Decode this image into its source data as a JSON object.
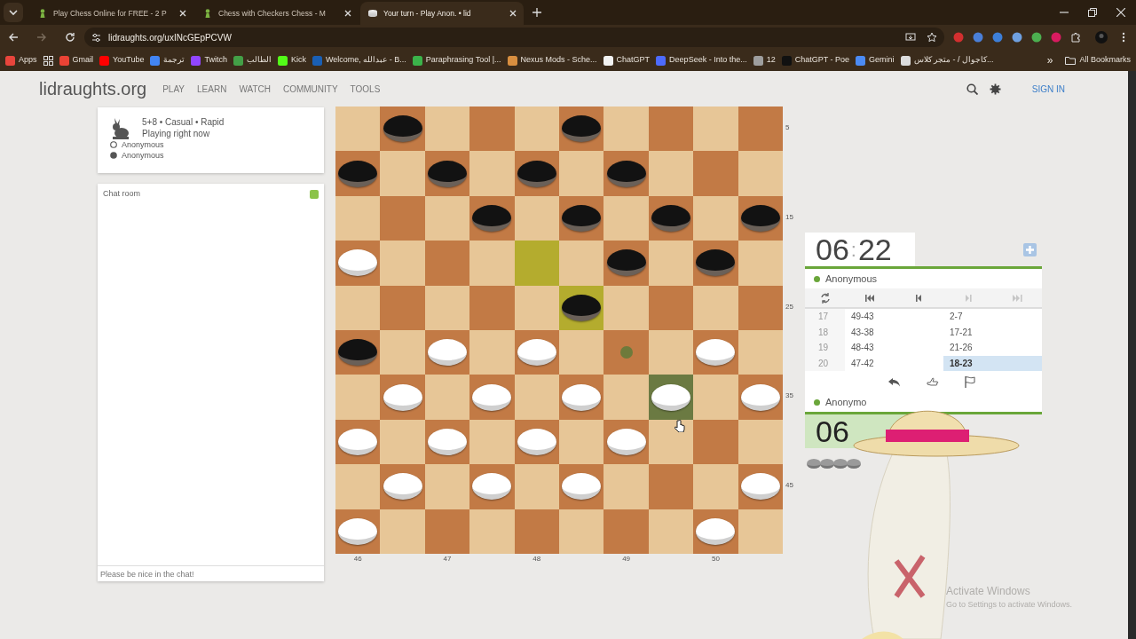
{
  "browser": {
    "tabs": [
      {
        "title": "Play Chess Online for FREE - 2 P",
        "kind": "pawn",
        "selected": false
      },
      {
        "title": "Chess with Checkers Chess - M",
        "kind": "pawn",
        "selected": false
      },
      {
        "title": "Your turn - Play Anon. • lid",
        "kind": "draughts",
        "selected": true
      }
    ],
    "url": "lidraughts.org/uxINcGEpPCVW",
    "bookmarks": [
      {
        "label": "Apps",
        "color": "#e8453c"
      },
      {
        "label": "Gmail",
        "color": "#ea4335"
      },
      {
        "label": "YouTube",
        "color": "#ff0000"
      },
      {
        "label": "ترجمة",
        "color": "#4285f4"
      },
      {
        "label": "Twitch",
        "color": "#9146ff"
      },
      {
        "label": "الطالب",
        "color": "#43a047"
      },
      {
        "label": "Kick",
        "color": "#53fc18"
      },
      {
        "label": "Welcome, عبدالله - B...",
        "color": "#1a5fb4"
      },
      {
        "label": "Paraphrasing Tool |...",
        "color": "#3bb34a"
      },
      {
        "label": "Nexus Mods - Sche...",
        "color": "#d98f40"
      },
      {
        "label": "ChatGPT",
        "color": "#f2f2f2"
      },
      {
        "label": "DeepSeek - Into the...",
        "color": "#4d6bfe"
      },
      {
        "label": "12",
        "color": "#9e9e9e"
      },
      {
        "label": "ChatGPT - Poe",
        "color": "#111111"
      },
      {
        "label": "Gemini",
        "color": "#4b8bf5"
      },
      {
        "label": "كاجوال / - متجر كلاس...",
        "color": "#dddddd"
      }
    ],
    "more_bookmarks": "»",
    "all_bookmarks": "All Bookmarks"
  },
  "site": {
    "logo": "lidraughts.org",
    "nav": [
      "PLAY",
      "LEARN",
      "WATCH",
      "COMMUNITY",
      "TOOLS"
    ],
    "sign_in": "SIGN IN"
  },
  "game_info": {
    "setup": "5+8 • Casual • Rapid",
    "status": "Playing right now",
    "players": [
      {
        "name": "Anonymous",
        "kind": "ring"
      },
      {
        "name": "Anonymous",
        "kind": "disc"
      }
    ]
  },
  "chat": {
    "title": "Chat room",
    "enabled": true,
    "placeholder": "Please be nice in the chat!"
  },
  "board": {
    "rows": [
      [
        {
          "kind": "empty",
          "last_move": false,
          "selected": false,
          "target": false
        },
        {
          "kind": "black",
          "last_move": false,
          "selected": false,
          "target": false
        },
        {
          "kind": "empty",
          "last_move": false,
          "selected": false,
          "target": false
        },
        {
          "kind": "empty",
          "last_move": false,
          "selected": false,
          "target": false
        },
        {
          "kind": "empty",
          "last_move": false,
          "selected": false,
          "target": false
        },
        {
          "kind": "black",
          "last_move": false,
          "selected": false,
          "target": false
        },
        {
          "kind": "empty",
          "last_move": false,
          "selected": false,
          "target": false
        },
        {
          "kind": "empty",
          "last_move": false,
          "selected": false,
          "target": false
        },
        {
          "kind": "empty",
          "last_move": false,
          "selected": false,
          "target": false
        },
        {
          "kind": "empty",
          "last_move": false,
          "selected": false,
          "target": false
        }
      ],
      [
        {
          "kind": "black",
          "last_move": false,
          "selected": false,
          "target": false
        },
        {
          "kind": "empty",
          "last_move": false,
          "selected": false,
          "target": false
        },
        {
          "kind": "black",
          "last_move": false,
          "selected": false,
          "target": false
        },
        {
          "kind": "empty",
          "last_move": false,
          "selected": false,
          "target": false
        },
        {
          "kind": "black",
          "last_move": false,
          "selected": false,
          "target": false
        },
        {
          "kind": "empty",
          "last_move": false,
          "selected": false,
          "target": false
        },
        {
          "kind": "black",
          "last_move": false,
          "selected": false,
          "target": false
        },
        {
          "kind": "empty",
          "last_move": false,
          "selected": false,
          "target": false
        },
        {
          "kind": "empty",
          "last_move": false,
          "selected": false,
          "target": false
        },
        {
          "kind": "empty",
          "last_move": false,
          "selected": false,
          "target": false
        }
      ],
      [
        {
          "kind": "empty",
          "last_move": false,
          "selected": false,
          "target": false
        },
        {
          "kind": "empty",
          "last_move": false,
          "selected": false,
          "target": false
        },
        {
          "kind": "empty",
          "last_move": false,
          "selected": false,
          "target": false
        },
        {
          "kind": "black",
          "last_move": false,
          "selected": false,
          "target": false
        },
        {
          "kind": "empty",
          "last_move": false,
          "selected": false,
          "target": false
        },
        {
          "kind": "black",
          "last_move": false,
          "selected": false,
          "target": false
        },
        {
          "kind": "empty",
          "last_move": false,
          "selected": false,
          "target": false
        },
        {
          "kind": "black",
          "last_move": false,
          "selected": false,
          "target": false
        },
        {
          "kind": "empty",
          "last_move": false,
          "selected": false,
          "target": false
        },
        {
          "kind": "black",
          "last_move": false,
          "selected": false,
          "target": false
        }
      ],
      [
        {
          "kind": "white",
          "last_move": false,
          "selected": false,
          "target": false
        },
        {
          "kind": "empty",
          "last_move": false,
          "selected": false,
          "target": false
        },
        {
          "kind": "empty",
          "last_move": false,
          "selected": false,
          "target": false
        },
        {
          "kind": "empty",
          "last_move": false,
          "selected": false,
          "target": false
        },
        {
          "kind": "empty",
          "last_move": true,
          "selected": false,
          "target": false
        },
        {
          "kind": "empty",
          "last_move": false,
          "selected": false,
          "target": false
        },
        {
          "kind": "black",
          "last_move": false,
          "selected": false,
          "target": false
        },
        {
          "kind": "empty",
          "last_move": false,
          "selected": false,
          "target": false
        },
        {
          "kind": "black",
          "last_move": false,
          "selected": false,
          "target": false
        },
        {
          "kind": "empty",
          "last_move": false,
          "selected": false,
          "target": false
        }
      ],
      [
        {
          "kind": "empty",
          "last_move": false,
          "selected": false,
          "target": false
        },
        {
          "kind": "empty",
          "last_move": false,
          "selected": false,
          "target": false
        },
        {
          "kind": "empty",
          "last_move": false,
          "selected": false,
          "target": false
        },
        {
          "kind": "empty",
          "last_move": false,
          "selected": false,
          "target": false
        },
        {
          "kind": "empty",
          "last_move": false,
          "selected": false,
          "target": false
        },
        {
          "kind": "black",
          "last_move": true,
          "selected": false,
          "target": false
        },
        {
          "kind": "empty",
          "last_move": false,
          "selected": false,
          "target": false
        },
        {
          "kind": "empty",
          "last_move": false,
          "selected": false,
          "target": false
        },
        {
          "kind": "empty",
          "last_move": false,
          "selected": false,
          "target": false
        },
        {
          "kind": "empty",
          "last_move": false,
          "selected": false,
          "target": false
        }
      ],
      [
        {
          "kind": "black",
          "last_move": false,
          "selected": false,
          "target": false
        },
        {
          "kind": "empty",
          "last_move": false,
          "selected": false,
          "target": false
        },
        {
          "kind": "white",
          "last_move": false,
          "selected": false,
          "target": false
        },
        {
          "kind": "empty",
          "last_move": false,
          "selected": false,
          "target": false
        },
        {
          "kind": "white",
          "last_move": false,
          "selected": false,
          "target": false
        },
        {
          "kind": "empty",
          "last_move": false,
          "selected": false,
          "target": false
        },
        {
          "kind": "empty",
          "last_move": false,
          "selected": false,
          "target": true
        },
        {
          "kind": "empty",
          "last_move": false,
          "selected": false,
          "target": false
        },
        {
          "kind": "white",
          "last_move": false,
          "selected": false,
          "target": false
        },
        {
          "kind": "empty",
          "last_move": false,
          "selected": false,
          "target": false
        }
      ],
      [
        {
          "kind": "empty",
          "last_move": false,
          "selected": false,
          "target": false
        },
        {
          "kind": "white",
          "last_move": false,
          "selected": false,
          "target": false
        },
        {
          "kind": "empty",
          "last_move": false,
          "selected": false,
          "target": false
        },
        {
          "kind": "white",
          "last_move": false,
          "selected": false,
          "target": false
        },
        {
          "kind": "empty",
          "last_move": false,
          "selected": false,
          "target": false
        },
        {
          "kind": "white",
          "last_move": false,
          "selected": false,
          "target": false
        },
        {
          "kind": "empty",
          "last_move": false,
          "selected": false,
          "target": false
        },
        {
          "kind": "white",
          "last_move": false,
          "selected": true,
          "target": false
        },
        {
          "kind": "empty",
          "last_move": false,
          "selected": false,
          "target": false
        },
        {
          "kind": "white",
          "last_move": false,
          "selected": false,
          "target": false
        }
      ],
      [
        {
          "kind": "white",
          "last_move": false,
          "selected": false,
          "target": false
        },
        {
          "kind": "empty",
          "last_move": false,
          "selected": false,
          "target": false
        },
        {
          "kind": "white",
          "last_move": false,
          "selected": false,
          "target": false
        },
        {
          "kind": "empty",
          "last_move": false,
          "selected": false,
          "target": false
        },
        {
          "kind": "white",
          "last_move": false,
          "selected": false,
          "target": false
        },
        {
          "kind": "empty",
          "last_move": false,
          "selected": false,
          "target": false
        },
        {
          "kind": "white",
          "last_move": false,
          "selected": false,
          "target": false
        },
        {
          "kind": "empty",
          "last_move": false,
          "selected": false,
          "target": false
        },
        {
          "kind": "empty",
          "last_move": false,
          "selected": false,
          "target": false
        },
        {
          "kind": "empty",
          "last_move": false,
          "selected": false,
          "target": false
        }
      ],
      [
        {
          "kind": "empty",
          "last_move": false,
          "selected": false,
          "target": false
        },
        {
          "kind": "white",
          "last_move": false,
          "selected": false,
          "target": false
        },
        {
          "kind": "empty",
          "last_move": false,
          "selected": false,
          "target": false
        },
        {
          "kind": "white",
          "last_move": false,
          "selected": false,
          "target": false
        },
        {
          "kind": "empty",
          "last_move": false,
          "selected": false,
          "target": false
        },
        {
          "kind": "white",
          "last_move": false,
          "selected": false,
          "target": false
        },
        {
          "kind": "empty",
          "last_move": false,
          "selected": false,
          "target": false
        },
        {
          "kind": "empty",
          "last_move": false,
          "selected": false,
          "target": false
        },
        {
          "kind": "empty",
          "last_move": false,
          "selected": false,
          "target": false
        },
        {
          "kind": "white",
          "last_move": false,
          "selected": false,
          "target": false
        }
      ],
      [
        {
          "kind": "white",
          "last_move": false,
          "selected": false,
          "target": false
        },
        {
          "kind": "empty",
          "last_move": false,
          "selected": false,
          "target": false
        },
        {
          "kind": "empty",
          "last_move": false,
          "selected": false,
          "target": false
        },
        {
          "kind": "empty",
          "last_move": false,
          "selected": false,
          "target": false
        },
        {
          "kind": "empty",
          "last_move": false,
          "selected": false,
          "target": false
        },
        {
          "kind": "empty",
          "last_move": false,
          "selected": false,
          "target": false
        },
        {
          "kind": "empty",
          "last_move": false,
          "selected": false,
          "target": false
        },
        {
          "kind": "empty",
          "last_move": false,
          "selected": false,
          "target": false
        },
        {
          "kind": "white",
          "last_move": false,
          "selected": false,
          "target": false
        },
        {
          "kind": "empty",
          "last_move": false,
          "selected": false,
          "target": false
        }
      ]
    ],
    "side_coords": [
      "5",
      "15",
      "25",
      "35",
      "45"
    ],
    "bottom_coords": [
      "46",
      "47",
      "48",
      "49",
      "50"
    ]
  },
  "top_clock": {
    "minutes": "06",
    "separator": ":",
    "seconds": "22"
  },
  "top_player": {
    "name": "Anonymous",
    "online": true
  },
  "nav_buttons": [
    {
      "kind": "flip",
      "disabled": false
    },
    {
      "kind": "first",
      "disabled": false
    },
    {
      "kind": "prev",
      "disabled": false
    },
    {
      "kind": "next",
      "disabled": true
    },
    {
      "kind": "last",
      "disabled": true
    }
  ],
  "moves": [
    {
      "index": "17",
      "white": {
        "text": "49-43",
        "selected": false
      },
      "black": {
        "text": "2-7",
        "selected": false
      }
    },
    {
      "index": "18",
      "white": {
        "text": "43-38",
        "selected": false
      },
      "black": {
        "text": "17-21",
        "selected": false
      }
    },
    {
      "index": "19",
      "white": {
        "text": "48-43",
        "selected": false
      },
      "black": {
        "text": "21-26",
        "selected": false
      }
    },
    {
      "index": "20",
      "white": {
        "text": "47-42",
        "selected": false
      },
      "black": {
        "text": "18-23",
        "selected": true
      }
    }
  ],
  "actions": [
    {
      "kind": "takeback"
    },
    {
      "kind": "draw"
    },
    {
      "kind": "resign"
    }
  ],
  "bottom_player": {
    "name": "Anonymo",
    "online": true
  },
  "bottom_clock": {
    "minutes": "06"
  },
  "captured": [
    {
      "kind": "black"
    },
    {
      "kind": "black"
    },
    {
      "kind": "black"
    },
    {
      "kind": "black"
    }
  ],
  "windows_notice": {
    "title": "Activate Windows",
    "subtitle": "Go to Settings to activate Windows."
  }
}
